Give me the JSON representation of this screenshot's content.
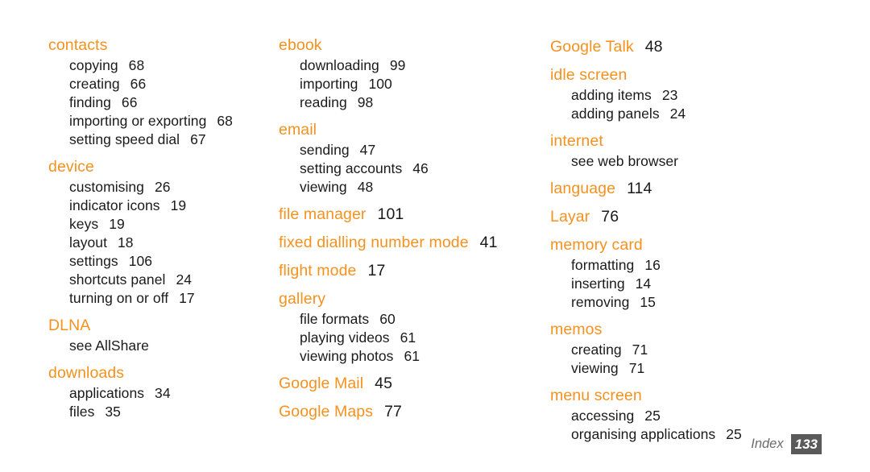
{
  "document": {
    "type": "index-page",
    "accent_color": "#f5911e",
    "text_color": "#1a1a1a",
    "background_color": "#ffffff",
    "footer_badge_color": "#5a5a5a"
  },
  "footer": {
    "label": "Index",
    "page_number": "133"
  },
  "columns": [
    {
      "id": "column-1",
      "groups": [
        {
          "heading": "contacts",
          "heading_page": "",
          "entries": [
            {
              "label": "copying",
              "page": "68"
            },
            {
              "label": "creating",
              "page": "66"
            },
            {
              "label": "finding",
              "page": "66"
            },
            {
              "label": "importing or exporting",
              "page": "68"
            },
            {
              "label": "setting speed dial",
              "page": "67"
            }
          ]
        },
        {
          "heading": "device",
          "heading_page": "",
          "entries": [
            {
              "label": "customising",
              "page": "26"
            },
            {
              "label": "indicator icons",
              "page": "19"
            },
            {
              "label": "keys",
              "page": "19"
            },
            {
              "label": "layout",
              "page": "18"
            },
            {
              "label": "settings",
              "page": "106"
            },
            {
              "label": "shortcuts panel",
              "page": "24"
            },
            {
              "label": "turning on or off",
              "page": "17"
            }
          ]
        },
        {
          "heading": "DLNA",
          "heading_page": "",
          "entries": [
            {
              "label": "see AllShare",
              "page": ""
            }
          ]
        },
        {
          "heading": "downloads",
          "heading_page": "",
          "entries": [
            {
              "label": "applications",
              "page": "34"
            },
            {
              "label": "files",
              "page": "35"
            }
          ]
        }
      ]
    },
    {
      "id": "column-2",
      "groups": [
        {
          "heading": "ebook",
          "heading_page": "",
          "entries": [
            {
              "label": "downloading",
              "page": "99"
            },
            {
              "label": "importing",
              "page": "100"
            },
            {
              "label": "reading",
              "page": "98"
            }
          ]
        },
        {
          "heading": "email",
          "heading_page": "",
          "entries": [
            {
              "label": "sending",
              "page": "47"
            },
            {
              "label": "setting accounts",
              "page": "46"
            },
            {
              "label": "viewing",
              "page": "48"
            }
          ]
        },
        {
          "heading": "file manager",
          "heading_page": "101",
          "entries": []
        },
        {
          "heading": "fixed dialling number mode",
          "heading_page": "41",
          "entries": []
        },
        {
          "heading": "flight mode",
          "heading_page": "17",
          "entries": []
        },
        {
          "heading": "gallery",
          "heading_page": "",
          "entries": [
            {
              "label": "file formats",
              "page": "60"
            },
            {
              "label": "playing videos",
              "page": "61"
            },
            {
              "label": "viewing photos",
              "page": "61"
            }
          ]
        },
        {
          "heading": "Google Mail",
          "heading_page": "45",
          "entries": []
        },
        {
          "heading": "Google Maps",
          "heading_page": "77",
          "entries": []
        }
      ]
    },
    {
      "id": "column-3",
      "groups": [
        {
          "heading": "Google Talk",
          "heading_page": "48",
          "entries": []
        },
        {
          "heading": "idle screen",
          "heading_page": "",
          "entries": [
            {
              "label": "adding items",
              "page": "23"
            },
            {
              "label": "adding panels",
              "page": "24"
            }
          ]
        },
        {
          "heading": "internet",
          "heading_page": "",
          "entries": [
            {
              "label": "see web browser",
              "page": ""
            }
          ]
        },
        {
          "heading": "language",
          "heading_page": "114",
          "entries": []
        },
        {
          "heading": "Layar",
          "heading_page": "76",
          "entries": []
        },
        {
          "heading": "memory card",
          "heading_page": "",
          "entries": [
            {
              "label": "formatting",
              "page": "16"
            },
            {
              "label": "inserting",
              "page": "14"
            },
            {
              "label": "removing",
              "page": "15"
            }
          ]
        },
        {
          "heading": "memos",
          "heading_page": "",
          "entries": [
            {
              "label": "creating",
              "page": "71"
            },
            {
              "label": "viewing",
              "page": "71"
            }
          ]
        },
        {
          "heading": "menu screen",
          "heading_page": "",
          "entries": [
            {
              "label": "accessing",
              "page": "25"
            },
            {
              "label": "organising applications",
              "page": "25"
            }
          ]
        }
      ]
    }
  ]
}
